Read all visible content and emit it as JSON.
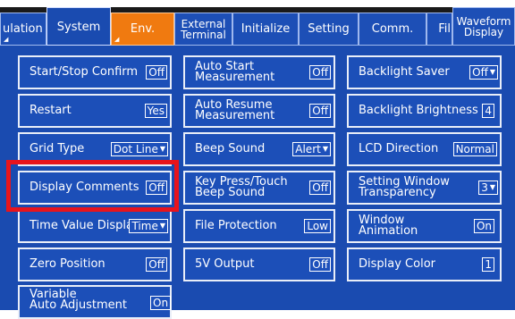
{
  "tabs": {
    "simulation": "ulation",
    "system": "System",
    "env": "Env.",
    "external_terminal": [
      "External",
      "Terminal"
    ],
    "initialize": "Initialize",
    "setting": "Setting",
    "comm": "Comm.",
    "file": "Fil",
    "waveform_display": [
      "Waveform",
      "Display"
    ]
  },
  "col1": {
    "start_stop_confirm": {
      "label": "Start/Stop Confirm",
      "value": "Off"
    },
    "restart": {
      "label": "Restart",
      "value": "Yes"
    },
    "grid_type": {
      "label": "Grid Type",
      "value": "Dot Line"
    },
    "display_comments": {
      "label": "Display Comments",
      "value": "Off"
    },
    "time_value_display": {
      "label": "Time Value Display",
      "value": "Time"
    },
    "zero_position": {
      "label": "Zero Position",
      "value": "Off"
    },
    "variable_auto_adjustment": {
      "label": [
        "Variable",
        "Auto Adjustment"
      ],
      "value": "On"
    }
  },
  "col2": {
    "auto_start_measurement": {
      "label": [
        "Auto Start",
        "Measurement"
      ],
      "value": "Off"
    },
    "auto_resume_measurement": {
      "label": [
        "Auto Resume",
        "Measurement"
      ],
      "value": "Off"
    },
    "beep_sound": {
      "label": "Beep Sound",
      "value": "Alert"
    },
    "key_press_touch_beep": {
      "label": [
        "Key Press/Touch",
        "Beep Sound"
      ],
      "value": "Off"
    },
    "file_protection": {
      "label": "File Protection",
      "value": "Low"
    },
    "five_v_output": {
      "label": "5V Output",
      "value": "Off"
    }
  },
  "col3": {
    "backlight_saver": {
      "label": "Backlight Saver",
      "value": "Off"
    },
    "backlight_brightness": {
      "label": "Backlight Brightness",
      "value": "4"
    },
    "lcd_direction": {
      "label": "LCD Direction",
      "value": "Normal"
    },
    "setting_window_transparency": {
      "label": [
        "Setting Window",
        "Transparency"
      ],
      "value": "3"
    },
    "window_animation": {
      "label": [
        "Window",
        "Animation"
      ],
      "value": "On"
    },
    "display_color": {
      "label": "Display Color",
      "value": "1"
    }
  },
  "colors": {
    "panel": "#1a4bb0",
    "env_tab": "#f07a10",
    "highlight": "#e8141c"
  }
}
